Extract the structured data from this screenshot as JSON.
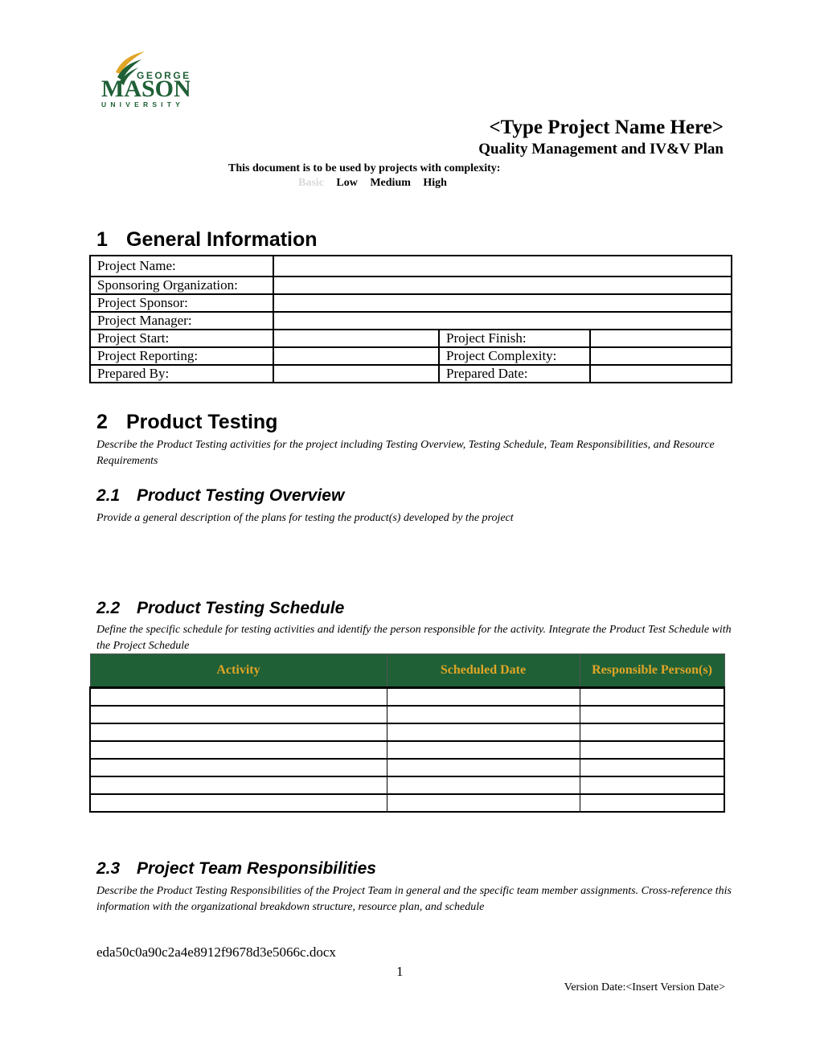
{
  "logo": {
    "line1": "GEORGE",
    "line2": "MASON",
    "line3": "UNIVERSITY",
    "colors": {
      "green": "#1f6037",
      "gold": "#e0a526"
    }
  },
  "header": {
    "title": "<Type Project Name Here>",
    "subtitle": "Quality Management and IV&V Plan",
    "used_by": "This document is to be used by projects with complexity:",
    "complexity_levels": [
      {
        "label": "Basic",
        "active": false
      },
      {
        "label": "Low",
        "active": true
      },
      {
        "label": "Medium",
        "active": true
      },
      {
        "label": "High",
        "active": true
      }
    ]
  },
  "sections": {
    "general": {
      "number": "1",
      "title": "General Information",
      "rows_full": [
        {
          "label": "Project Name:",
          "value": ""
        },
        {
          "label": "Sponsoring Organization:",
          "value": ""
        },
        {
          "label": "Project Sponsor:",
          "value": ""
        },
        {
          "label": "Project Manager:",
          "value": ""
        }
      ],
      "rows_split": [
        {
          "label": "Project Start:",
          "value": "",
          "label2": "Project Finish:",
          "value2": ""
        },
        {
          "label": "Project Reporting:",
          "value": "",
          "label2": "Project Complexity:",
          "value2": ""
        },
        {
          "label": "Prepared By:",
          "value": "",
          "label2": "Prepared Date:",
          "value2": ""
        }
      ]
    },
    "testing": {
      "number": "2",
      "title": "Product Testing",
      "description": "Describe the Product Testing activities for the project including Testing Overview, Testing Schedule, Team Responsibilities, and Resource Requirements"
    },
    "overview": {
      "number": "2.1",
      "title": "Product Testing Overview",
      "description": "Provide a general description of the plans for testing the product(s) developed by the project"
    },
    "schedule": {
      "number": "2.2",
      "title": "Product Testing Schedule",
      "description": "Define the specific schedule for testing activities and identify the person responsible for the activity.  Integrate the Product Test Schedule with the Project Schedule",
      "columns": [
        "Activity",
        "Scheduled Date",
        "Responsible Person(s)"
      ],
      "rows": [
        [
          "",
          "",
          ""
        ],
        [
          "",
          "",
          ""
        ],
        [
          "",
          "",
          ""
        ],
        [
          "",
          "",
          ""
        ],
        [
          "",
          "",
          ""
        ],
        [
          "",
          "",
          ""
        ],
        [
          "",
          "",
          ""
        ]
      ]
    },
    "responsibilities": {
      "number": "2.3",
      "title": "Project Team Responsibilities",
      "description": "Describe the Product Testing Responsibilities of the Project Team in general and the specific team member assignments.  Cross-reference this information with the organizational breakdown structure, resource plan, and schedule"
    }
  },
  "footer": {
    "filename": "eda50c0a90c2a4e8912f9678d3e5066c.docx",
    "page_number": "1",
    "version_date": "Version Date:<Insert Version Date>"
  }
}
